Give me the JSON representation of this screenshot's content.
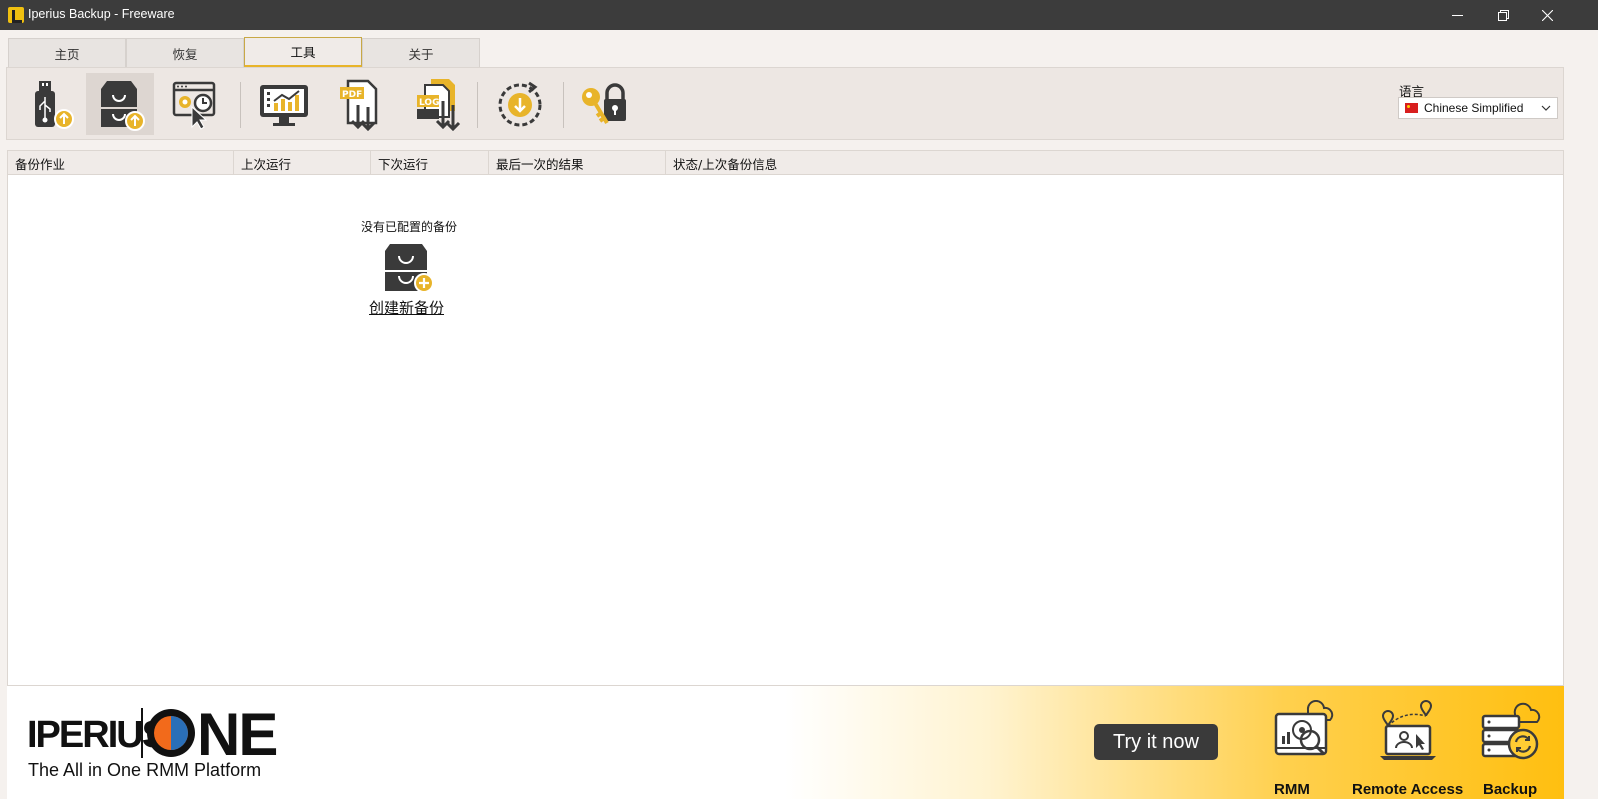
{
  "window": {
    "title": "Iperius Backup - Freeware",
    "controls": [
      "minimize-icon",
      "restore-icon",
      "close-icon"
    ]
  },
  "tabs": [
    {
      "label": "主页",
      "active": false
    },
    {
      "label": "恢复",
      "active": false
    },
    {
      "label": "工具",
      "active": true
    },
    {
      "label": "关于",
      "active": false
    }
  ],
  "toolbar": {
    "tools": [
      {
        "icon": "usb-backup-icon"
      },
      {
        "icon": "archive-backup-icon",
        "selected": true
      },
      {
        "icon": "scheduled-settings-icon"
      },
      {
        "icon": "monitor-chart-icon"
      },
      {
        "icon": "pdf-download-icon"
      },
      {
        "icon": "log-download-icon"
      },
      {
        "icon": "update-download-icon"
      },
      {
        "icon": "key-lock-icon"
      }
    ],
    "language_label": "语言",
    "language_value": "Chinese Simplified"
  },
  "backup_list": {
    "columns": [
      "备份作业",
      "上次运行",
      "下次运行",
      "最后一次的结果",
      "状态/上次备份信息"
    ],
    "rows": [],
    "empty_message": "没有已配置的备份",
    "create_link": "创建新备份"
  },
  "banner": {
    "brand_text": "IPERIUS",
    "brand_suffix": "NE",
    "tagline": "The All in One RMM Platform",
    "cta": "Try it now",
    "products": [
      "RMM",
      "Remote Access",
      "Backup"
    ]
  },
  "colors": {
    "accent": "#e8b42a",
    "icon_dark": "#3a3a3a",
    "titlebar": "#3c3c3c"
  }
}
